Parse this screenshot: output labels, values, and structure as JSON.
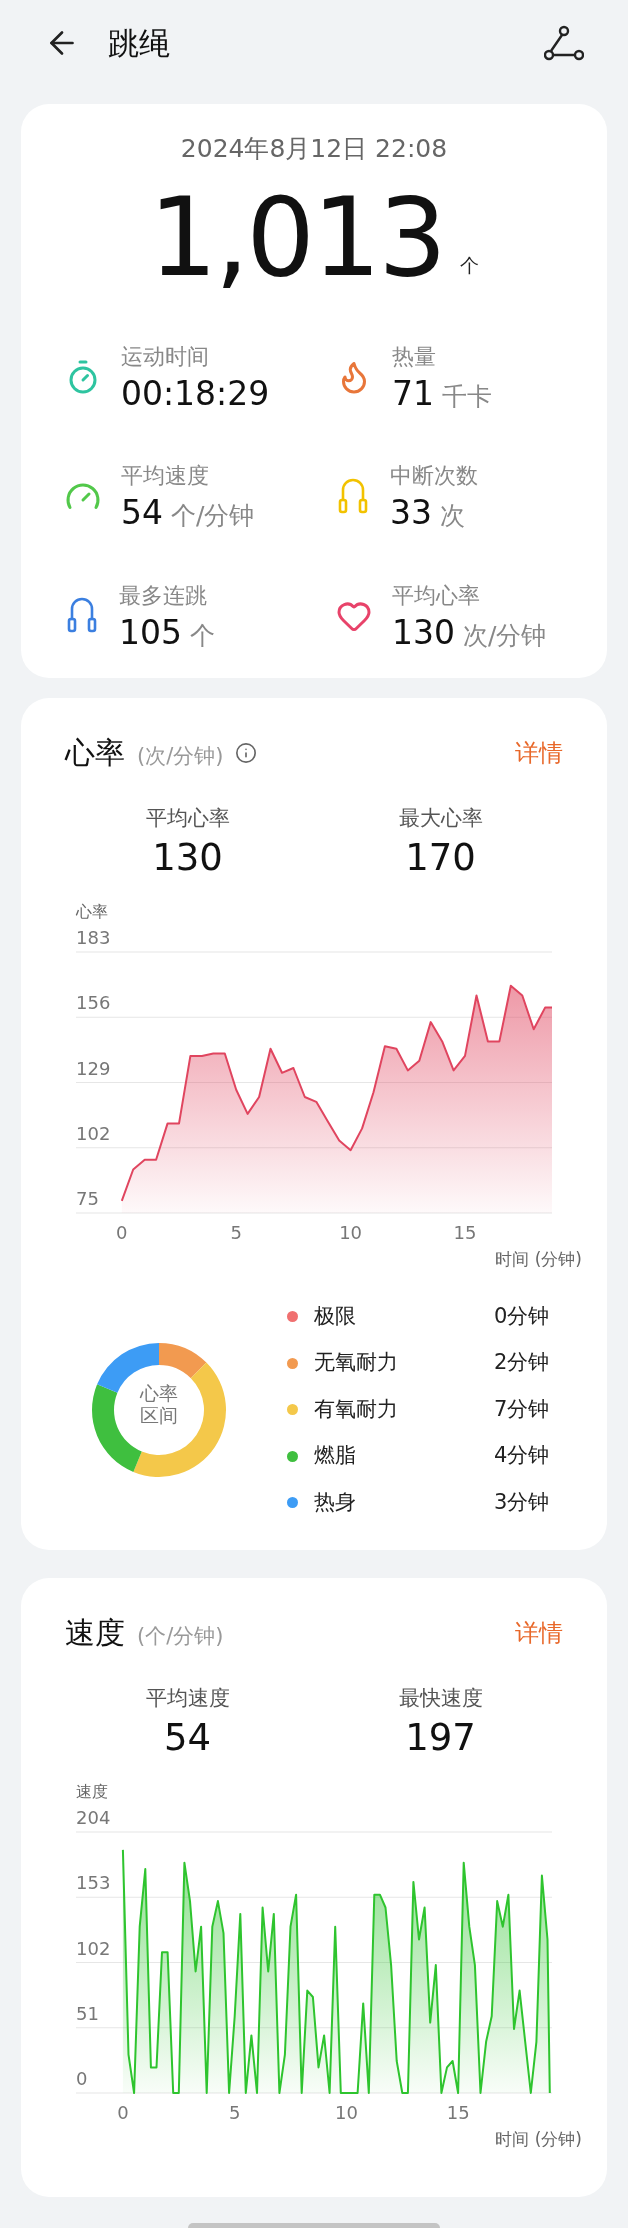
{
  "header": {
    "title": "跳绳"
  },
  "summary": {
    "datetime": "2024年8月12日 22:08",
    "count": "1,013",
    "count_unit": "个",
    "stats": [
      {
        "label": "运动时间",
        "value": "00:18:29"
      },
      {
        "label": "热量",
        "value": "71",
        "unit": "千卡"
      },
      {
        "label": "平均速度",
        "value": "54",
        "unit": "个/分钟"
      },
      {
        "label": "中断次数",
        "value": "33",
        "unit": "次"
      },
      {
        "label": "最多连跳",
        "value": "105",
        "unit": "个"
      },
      {
        "label": "平均心率",
        "value": "130",
        "unit": "次/分钟"
      }
    ]
  },
  "heart_rate": {
    "title": "心率",
    "unit": "(次/分钟)",
    "details": "详情",
    "metrics": [
      {
        "label": "平均心率",
        "value": "130"
      },
      {
        "label": "最大心率",
        "value": "170"
      }
    ],
    "chart_data": {
      "type": "area",
      "grid": true,
      "xlabel": "时间 (分钟)",
      "xlim": [
        -2,
        18.8
      ],
      "ylim": [
        75,
        183
      ],
      "yticks": [
        75,
        102,
        129,
        156,
        183
      ],
      "xticks": [
        0,
        5,
        10,
        15
      ],
      "x": [
        0,
        0.5,
        1,
        1.5,
        2,
        2.5,
        3,
        3.5,
        4,
        4.5,
        5,
        5.5,
        6,
        6.5,
        7,
        7.5,
        8,
        8.5,
        9,
        9.5,
        10,
        10.5,
        11,
        11.5,
        12,
        12.5,
        13,
        13.5,
        14,
        14.5,
        15,
        15.5,
        16,
        16.5,
        17,
        17.5,
        18,
        18.5,
        18.8
      ],
      "series": [
        {
          "name": "心率",
          "color": "#e0455f",
          "values": [
            80,
            93,
            97,
            97,
            112,
            112,
            140,
            140,
            141,
            141,
            126,
            116,
            123,
            143,
            133,
            135,
            123,
            121,
            113,
            105,
            101,
            110,
            125,
            144,
            143,
            134,
            138,
            154,
            146,
            134,
            140,
            165,
            146,
            146,
            169,
            165,
            151,
            160,
            160
          ]
        }
      ]
    },
    "zones_chart": {
      "center_label": "心率区间",
      "chart_data": {
        "type": "donut",
        "values": [
          0,
          12.5,
          43.75,
          25,
          18.75
        ]
      }
    },
    "zones": [
      {
        "label": "极限",
        "duration": "0分钟",
        "color": "#f07070"
      },
      {
        "label": "无氧耐力",
        "duration": "2分钟",
        "color": "#f29a50"
      },
      {
        "label": "有氧耐力",
        "duration": "7分钟",
        "color": "#f4c84a"
      },
      {
        "label": "燃脂",
        "duration": "4分钟",
        "color": "#3fbf3f"
      },
      {
        "label": "热身",
        "duration": "3分钟",
        "color": "#3d9cf5"
      }
    ]
  },
  "speed": {
    "title": "速度",
    "unit": "(个/分钟)",
    "details": "详情",
    "metrics": [
      {
        "label": "平均速度",
        "value": "54"
      },
      {
        "label": "最快速度",
        "value": "197"
      }
    ],
    "chart_data": {
      "type": "area",
      "grid": true,
      "xlabel": "时间 (分钟)",
      "xlim": [
        -2.1,
        19.2
      ],
      "ylim": [
        0,
        204
      ],
      "yticks": [
        0,
        51,
        102,
        153,
        204
      ],
      "xticks": [
        0,
        5,
        10,
        15
      ],
      "x": [
        0,
        0.25,
        0.5,
        0.75,
        1,
        1.25,
        1.5,
        1.75,
        2,
        2.25,
        2.5,
        2.75,
        3,
        3.25,
        3.5,
        3.75,
        4,
        4.25,
        4.5,
        4.75,
        5,
        5.25,
        5.5,
        5.75,
        6,
        6.25,
        6.5,
        6.75,
        7,
        7.25,
        7.5,
        7.75,
        8,
        8.25,
        8.5,
        8.75,
        9,
        9.25,
        9.5,
        9.75,
        10,
        10.25,
        10.5,
        10.75,
        11,
        11.25,
        11.5,
        11.75,
        12,
        12.25,
        12.5,
        12.75,
        13,
        13.25,
        13.5,
        13.75,
        14,
        14.25,
        14.5,
        14.75,
        15,
        15.25,
        15.5,
        15.75,
        16,
        16.25,
        16.5,
        16.75,
        17,
        17.25,
        17.5,
        17.75,
        18,
        18.25,
        18.5,
        18.75,
        19,
        19.1
      ],
      "series": [
        {
          "name": "速度",
          "color": "#2ec42e",
          "values": [
            190,
            30,
            0,
            130,
            175,
            20,
            20,
            110,
            110,
            0,
            0,
            180,
            150,
            95,
            130,
            0,
            130,
            150,
            125,
            0,
            60,
            140,
            0,
            45,
            0,
            145,
            95,
            140,
            0,
            30,
            130,
            155,
            0,
            80,
            75,
            20,
            45,
            0,
            130,
            0,
            0,
            0,
            0,
            70,
            0,
            155,
            155,
            145,
            100,
            25,
            0,
            0,
            165,
            120,
            145,
            55,
            100,
            0,
            20,
            25,
            0,
            180,
            130,
            100,
            0,
            40,
            60,
            150,
            130,
            155,
            50,
            80,
            40,
            0,
            40,
            170,
            120,
            0
          ]
        }
      ]
    }
  }
}
